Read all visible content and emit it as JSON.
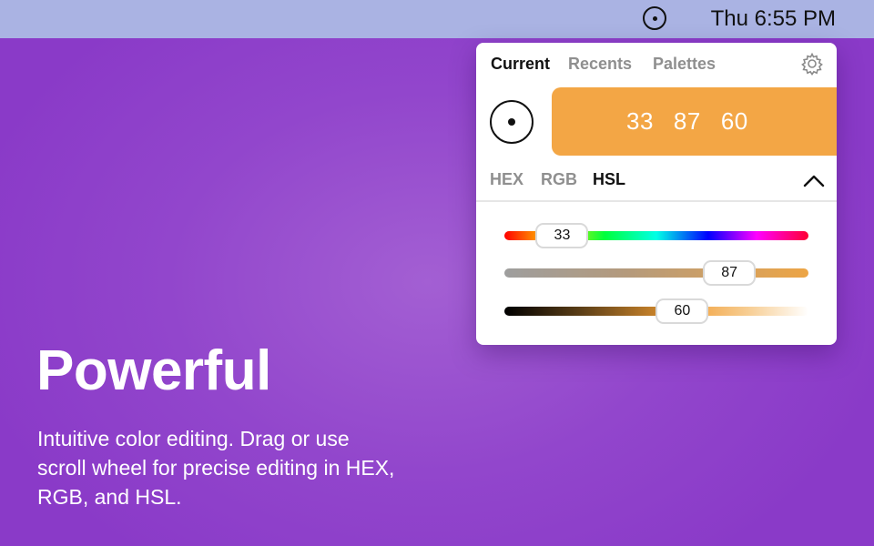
{
  "menubar": {
    "clock": "Thu 6:55 PM",
    "icon": "color-picker-icon"
  },
  "panel": {
    "tabs": [
      {
        "label": "Current",
        "active": true
      },
      {
        "label": "Recents",
        "active": false
      },
      {
        "label": "Palettes",
        "active": false
      }
    ],
    "settings_icon": "gear-icon",
    "picker_icon": "eyedropper-target-icon",
    "color": {
      "hex": "#F3A645",
      "values": [
        "33",
        "87",
        "60"
      ]
    },
    "modes": [
      {
        "label": "HEX",
        "active": false
      },
      {
        "label": "RGB",
        "active": false
      },
      {
        "label": "HSL",
        "active": true
      }
    ],
    "collapse_icon": "chevron-up-icon",
    "sliders": [
      {
        "name": "hue",
        "value": "33",
        "fraction": 0.19
      },
      {
        "name": "saturation",
        "value": "87",
        "fraction": 0.74
      },
      {
        "name": "lightness",
        "value": "60",
        "fraction": 0.585
      }
    ]
  },
  "hero": {
    "title": "Powerful",
    "description": "Intuitive color editing. Drag or use scroll wheel for precise editing in HEX, RGB, and HSL."
  }
}
